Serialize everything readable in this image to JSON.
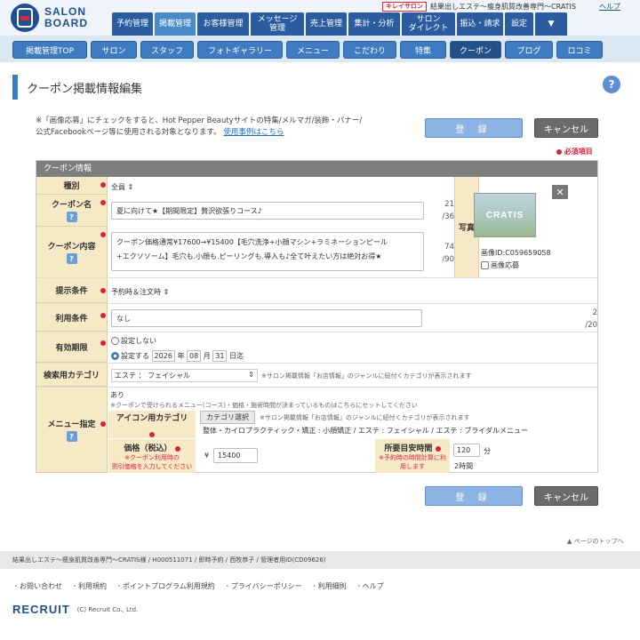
{
  "header": {
    "logo_line1": "SALON",
    "logo_line2": "BOARD",
    "badge": "キレイサロン",
    "salon_name": "結果出しエステ～瘦身肌質改善専門～CRATIS",
    "help": "ヘルプ",
    "nav": [
      {
        "label": "予約管理"
      },
      {
        "label": "掲載管理"
      },
      {
        "label": "お客様管理"
      },
      {
        "label": "メッセージ\n管理"
      },
      {
        "label": "売上管理"
      },
      {
        "label": "集計・分析"
      },
      {
        "label": "サロン\nダイレクト"
      },
      {
        "label": "振込・請求"
      },
      {
        "label": "設定"
      },
      {
        "label": "▼"
      }
    ]
  },
  "subnav": [
    {
      "label": "掲載管理TOP"
    },
    {
      "label": "サロン"
    },
    {
      "label": "スタッフ"
    },
    {
      "label": "フォトギャラリー"
    },
    {
      "label": "メニュー"
    },
    {
      "label": "こだわり"
    },
    {
      "label": "特集"
    },
    {
      "label": "クーポン"
    },
    {
      "label": "ブログ"
    },
    {
      "label": "ロコミ"
    }
  ],
  "page": {
    "title": "クーポン掲載情報編集",
    "help_icon": "?",
    "note_line1": "※「画像応募」にチェックをすると、Hot Pepper Beautyサイトの特集/メルマガ/装飾・バナー/",
    "note_line2": "公式Facebookページ等に使用される対象となります。",
    "note_link": "使用事例はこちら",
    "register": "登 録",
    "cancel": "キャンセル",
    "required_legend": "必須項目"
  },
  "form": {
    "panel_title": "クーポン情報",
    "type": {
      "label": "種別",
      "value": "全員"
    },
    "name": {
      "label": "クーポン名",
      "value": "夏に向けて★【期間限定】贅沢欲張りコース♪",
      "count": "21",
      "max": "/36"
    },
    "content": {
      "label": "クーポン内容",
      "line1": "クーポン価格通常¥17600→¥15400【毛穴洗浄+小顔マシン+ラミネーションピール",
      "line2": "+エクソソーム】毛穴も.小顔も.ピーリングも.導入も♪全て叶えたい方は絶対お得★",
      "count": "74",
      "max": "/90"
    },
    "photo": {
      "label": "写真",
      "image_text": "CRATIS",
      "close": "✕",
      "image_id": "画像ID:C059659058",
      "apply": "画像応募"
    },
    "presentation": {
      "label": "提示条件",
      "value": "予約時＆注文時"
    },
    "usage": {
      "label": "利用条件",
      "value": "なし",
      "count": "2",
      "max": "/20"
    },
    "validity": {
      "label": "有効期限",
      "opt_none": "設定しない",
      "opt_set": "設定する",
      "year": "2026",
      "year_unit": "年",
      "month": "08",
      "month_unit": "月",
      "day": "31",
      "day_unit": "日迄"
    },
    "category": {
      "label": "検索用カテゴリ",
      "value": "エステ ： フェイシャル",
      "note": "※サロン掲載情報「お店情報」のジャンルに紐付くカテゴリが表示されます"
    },
    "menu": {
      "label": "メニュー指定",
      "value": "あり",
      "note": "※クーポンで受けられるメニュー(コース)・価格・施術時間が決まっているものはこちらにセットしてください",
      "icon_category_label": "アイコン用カテゴリ",
      "category_select": "カテゴリ選択",
      "category_note": "※サロン掲載情報「お店情報」のジャンルに紐付くカテゴリが表示されます",
      "category_values": "整体・カイロプラクティック・矯正 : 小顔矯正 / エステ : フェイシャル / エステ : ブライダルメニュー",
      "price_label": "価格（税込）",
      "price_note1": "※クーポン利用時の",
      "price_note2": "割引価格を入力してください",
      "currency": "¥",
      "price": "15400",
      "time_label": "所要目安時間",
      "time_note1": "※予約時の時間計算に利",
      "time_note2": "用します",
      "time_value": "120",
      "time_unit": "分",
      "time_display": "2時間"
    }
  },
  "footer": {
    "page_top": "▲ ページのトップへ",
    "info": "結果出しエステ～瘦身肌質改善専門～CRATIS様 / H000511071 / 即時予約 / 西牧恭子 / 管理者用ID(CD09626)",
    "links": [
      "お問い合わせ",
      "利用規約",
      "ポイントプログラム利用規約",
      "プライバシーポリシー",
      "利用細則",
      "ヘルプ"
    ],
    "brand": "RECRUIT",
    "copyright": "(C) Recruit Co., Ltd."
  }
}
